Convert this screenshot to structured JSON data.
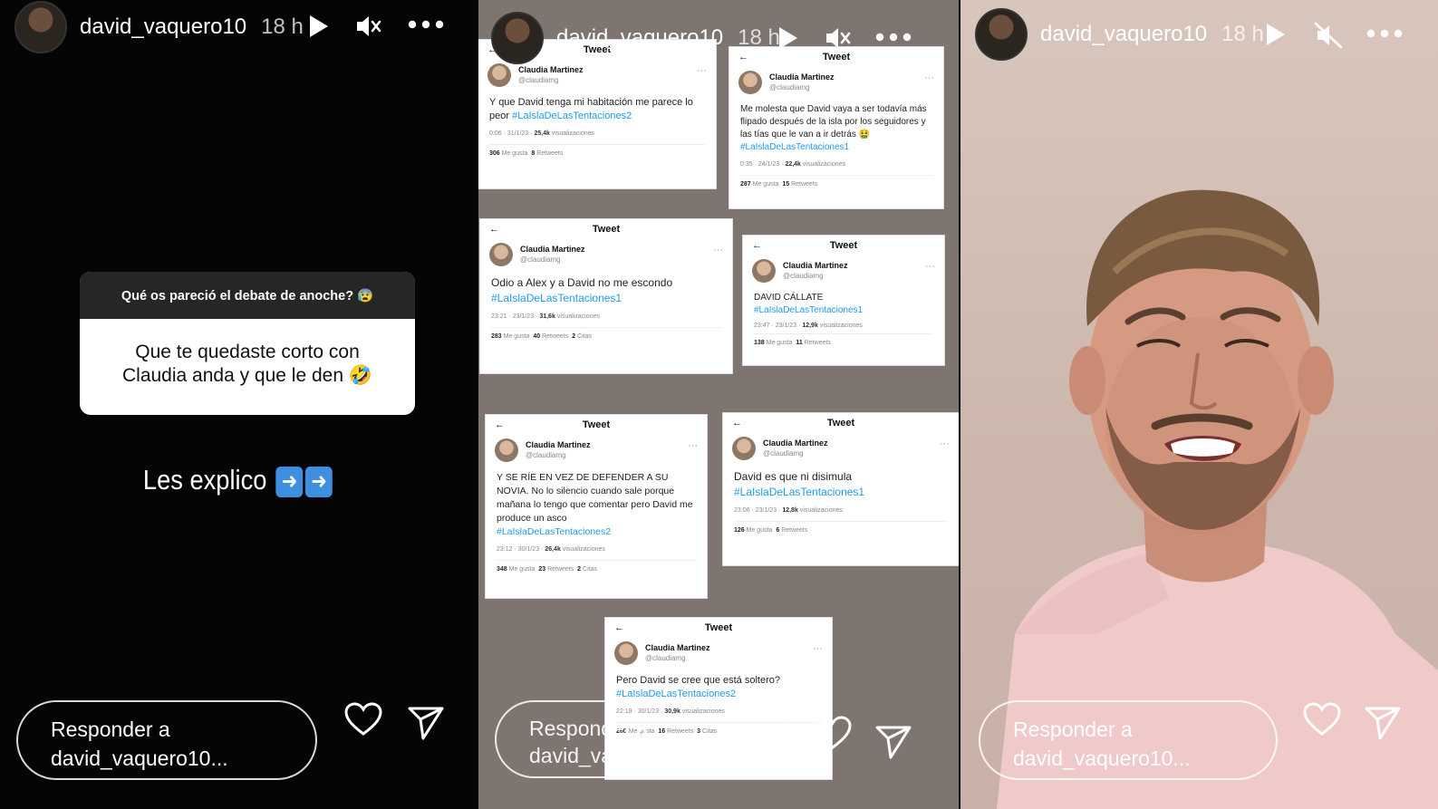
{
  "story_header": {
    "username": "david_vaquero10",
    "time": "18 h"
  },
  "panel1": {
    "question": "Qué os pareció el debate de anoche? 😰",
    "answer_line1": "Que te quedaste corto con",
    "answer_line2": "Claudia anda y que le den 🤣",
    "caption": "Les explico"
  },
  "tweets": [
    {
      "name": "Claudia Martinez",
      "handle": "@claudiamg",
      "text": "Y que David tenga mi habitación me parece lo peor",
      "tag": "#LaIslaDeLasTentaciones2",
      "meta_time": "0:06 · 31/1/23 ·",
      "views": "25,4k",
      "views_label": "visualizaciones",
      "likes": "306",
      "likes_label": "Me gusta",
      "retweets": "8",
      "retweets_label": "Retweets",
      "quotes": "",
      "quotes_label": ""
    },
    {
      "name": "Claudia Martinez",
      "handle": "@claudiamg",
      "text": "Me molesta que David vaya a ser todavía más flipado después de la isla por los seguidores y las tías que le van a ir detrás 🤮",
      "tag": "#LaIslaDeLasTentaciones1",
      "meta_time": "0:35 · 24/1/23 ·",
      "views": "22,4k",
      "views_label": "visualizaciones",
      "likes": "287",
      "likes_label": "Me gusta",
      "retweets": "15",
      "retweets_label": "Retweets",
      "quotes": "",
      "quotes_label": ""
    },
    {
      "name": "Claudia Martinez",
      "handle": "@claudiamg",
      "text": "Odio a Alex y a David no me escondo",
      "tag": "#LaIslaDeLasTentaciones1",
      "meta_time": "23:21 · 23/1/23 ·",
      "views": "31,6k",
      "views_label": "visualizaciones",
      "likes": "283",
      "likes_label": "Me gusta",
      "retweets": "40",
      "retweets_label": "Retweets",
      "quotes": "2",
      "quotes_label": "Citas"
    },
    {
      "name": "Claudia Martinez",
      "handle": "@claudiamg",
      "text": "DAVID CÁLLATE",
      "tag": "#LaIslaDeLasTentaciones1",
      "meta_time": "23:47 · 23/1/23 ·",
      "views": "12,9k",
      "views_label": "visualizaciones",
      "likes": "138",
      "likes_label": "Me gusta",
      "retweets": "11",
      "retweets_label": "Retweets",
      "quotes": "",
      "quotes_label": ""
    },
    {
      "name": "Claudia Martinez",
      "handle": "@claudiamg",
      "text": "Y SE RÍE EN VEZ DE DEFENDER A SU NOVIA. No lo silencio cuando sale porque mañana lo tengo que comentar pero David me produce un asco",
      "tag": "#LaIslaDeLasTentaciones2",
      "meta_time": "23:12 · 30/1/23 ·",
      "views": "26,4k",
      "views_label": "visualizaciones",
      "likes": "348",
      "likes_label": "Me gusta",
      "retweets": "23",
      "retweets_label": "Retweets",
      "quotes": "2",
      "quotes_label": "Citas"
    },
    {
      "name": "Claudia Martinez",
      "handle": "@claudiamg",
      "text": "David es que ni disimula",
      "tag": "#LaIslaDeLasTentaciones1",
      "meta_time": "23:06 · 23/1/23 ·",
      "views": "12,8k",
      "views_label": "visualizaciones",
      "likes": "126",
      "likes_label": "Me gusta",
      "retweets": "6",
      "retweets_label": "Retweets",
      "quotes": "",
      "quotes_label": ""
    },
    {
      "name": "Claudia Martinez",
      "handle": "@claudiamg",
      "text": "Pero David se cree que está soltero?",
      "tag": "#LaIslaDeLasTentaciones2",
      "meta_time": "22:19 · 30/1/23 ·",
      "views": "30,9k",
      "views_label": "visualizaciones",
      "likes": "260",
      "likes_label": "Me gusta",
      "retweets": "16",
      "retweets_label": "Retweets",
      "quotes": "3",
      "quotes_label": "Citas"
    }
  ],
  "tweet_header": "Tweet",
  "reply_line1": "Responder a",
  "reply_line2": "david_vaquero10...",
  "colors": {
    "hashtag": "#1d9bf0",
    "panel1_bg": "#050505",
    "panel2_bg": "#7e7570"
  },
  "icons": [
    "play-icon",
    "mute-icon",
    "more-icon",
    "heart-icon",
    "send-icon",
    "arrow-right-emoji"
  ]
}
